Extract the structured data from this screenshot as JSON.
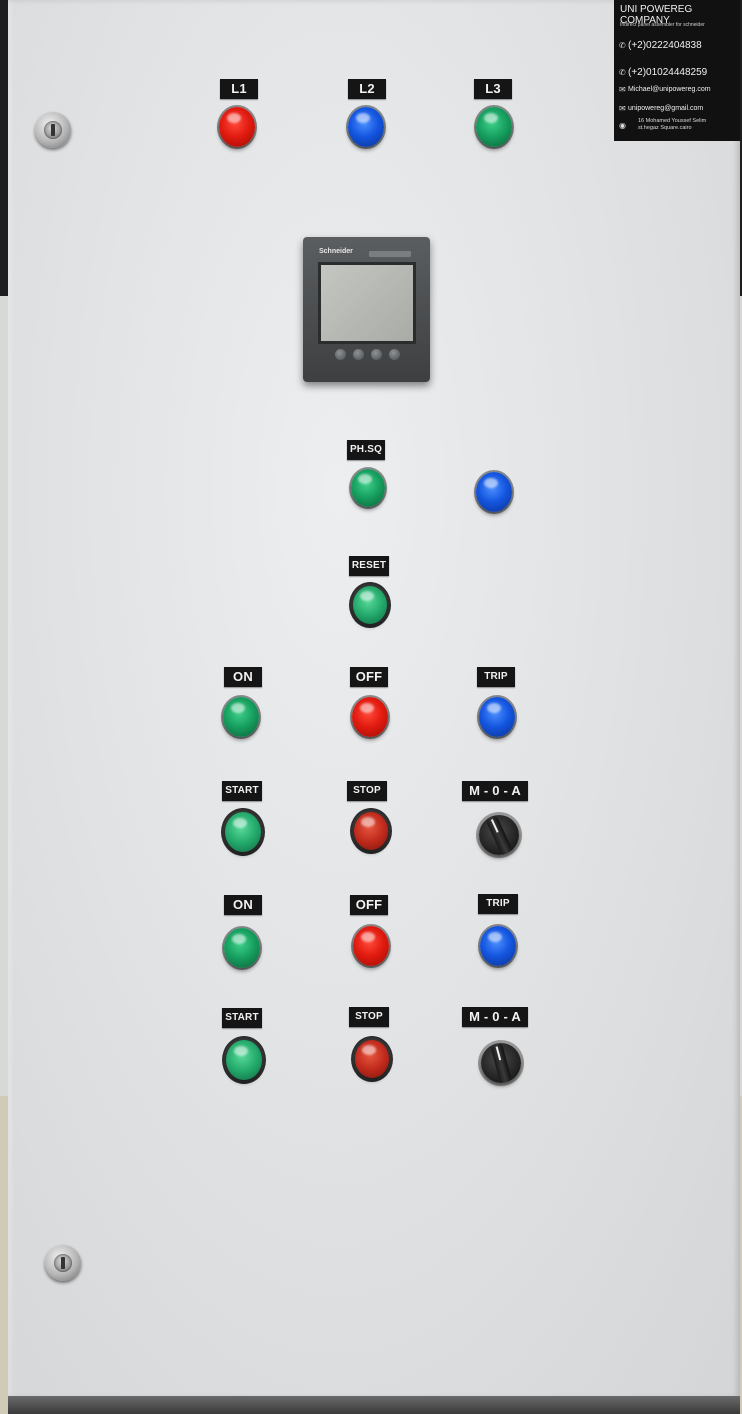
{
  "labels": {
    "l1": "L1",
    "l2": "L2",
    "l3": "L3",
    "phsq": "PH.SQ",
    "reset": "RESET",
    "on1": "ON",
    "off1": "OFF",
    "trip1": "TRIP",
    "start1": "START",
    "stop1": "STOP",
    "moa1": "M - 0 - A",
    "on2": "ON",
    "off2": "OFF",
    "trip2": "TRIP",
    "start2": "START",
    "stop2": "STOP",
    "moa2": "M - 0 - A"
  },
  "meter": {
    "brand": "Schneider"
  },
  "card": {
    "company": "UNI POWEREG COMPANY",
    "subtitle": "Indirect panel assembler for schneider",
    "phone1": "(+2)0222404838",
    "phone2": "(+2)01024448259",
    "email1": "Michael@unipowereg.com",
    "email2": "unipowereg@gmail.com",
    "address_line1": "16 Mohamed Youssef Selim",
    "address_line2": "st.hegaz Square.cairo"
  },
  "colors": {
    "lamp_red": "#e21b10",
    "lamp_blue": "#1456e0",
    "lamp_green": "#17a060",
    "panel": "#e1e3e5",
    "label_bg": "#151515"
  }
}
